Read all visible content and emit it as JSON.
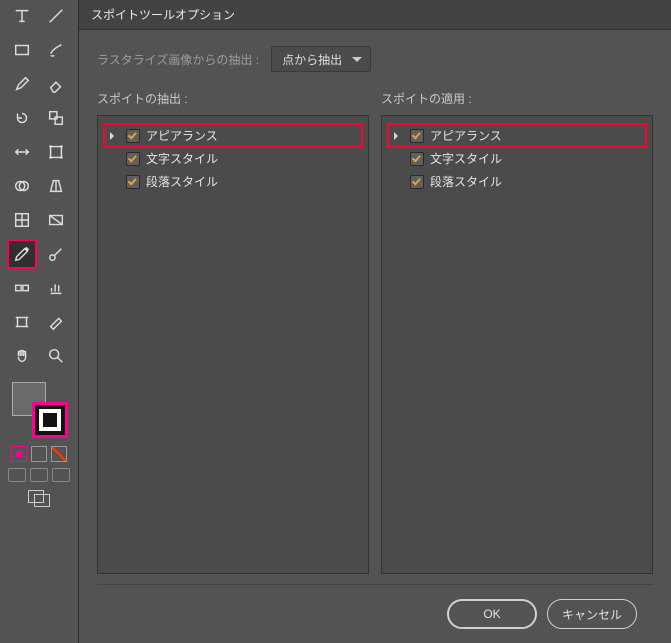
{
  "dialog": {
    "title": "スポイトツールオプション",
    "raster_label": "ラスタライズ画像からの抽出 :",
    "raster_value": "点から抽出",
    "sample_title": "スポイトの抽出 :",
    "apply_title": "スポイトの適用 :",
    "items": {
      "appearance": "アピアランス",
      "char_style": "文字スタイル",
      "para_style": "段落スタイル"
    },
    "ok": "OK",
    "cancel": "キャンセル"
  },
  "tools": {
    "selection": "selection-tool",
    "direct_selection": "direct-selection-tool",
    "type": "type-tool",
    "eyedropper": "eyedropper-tool"
  }
}
